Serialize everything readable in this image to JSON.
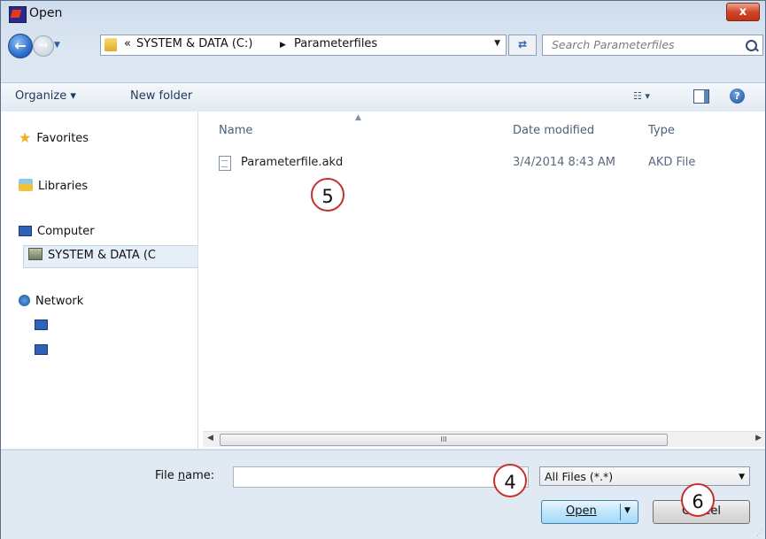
{
  "window": {
    "title": "Open",
    "close_label": "x"
  },
  "nav": {
    "back_label": "←",
    "forward_label": "→",
    "breadcrumb": {
      "overflow": "«",
      "drive": "SYSTEM & DATA (C:)",
      "sep": "▶",
      "folder": "Parameterfiles"
    },
    "refresh_label": "⇄",
    "search_placeholder": "Search Parameterfiles"
  },
  "toolbar": {
    "organize_label": "Organize ▾",
    "new_folder_label": "New folder",
    "views_label": "☷ ▾",
    "help_label": "?"
  },
  "sidebar": {
    "favorites": "Favorites",
    "libraries": "Libraries",
    "computer": "Computer",
    "drive": "SYSTEM & DATA (C",
    "network": "Network"
  },
  "file_list": {
    "columns": [
      "Name",
      "Date modified",
      "Type"
    ],
    "rows": [
      {
        "name": "Parameterfile.akd",
        "date": "3/4/2014 8:43 AM",
        "type": "AKD File"
      }
    ]
  },
  "scrollbar": {
    "thumb_label": "III"
  },
  "bottom": {
    "file_name_label": "File name:",
    "file_name_value": "",
    "filter_value": "All Files (*.*)",
    "open_label": "Open",
    "cancel_label": "Cancel"
  },
  "callouts": [
    "5",
    "4",
    "6"
  ]
}
